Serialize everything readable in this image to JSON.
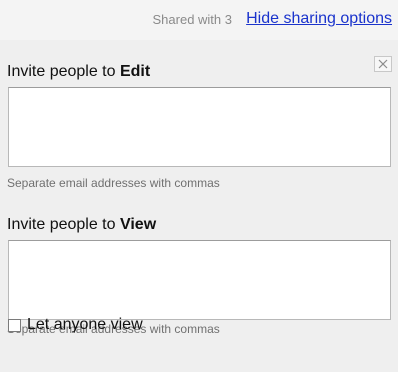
{
  "sharing": {
    "shared_count_text": "Shared with 3",
    "hide_link_text": "Hide sharing options"
  },
  "close_icon": "close-icon",
  "invite_edit": {
    "label_prefix": "Invite people to ",
    "label_bold": "Edit",
    "value": "",
    "hint": "Separate email addresses with commas"
  },
  "invite_view": {
    "label_prefix": "Invite people to ",
    "label_bold": "View",
    "value": "",
    "hint": "Separate email addresses with commas"
  },
  "anyone_view": {
    "label": "Let anyone view",
    "checked": false
  },
  "colors": {
    "link": "#1a33cc",
    "panel_bg": "#efefef",
    "hint_text": "#707070"
  }
}
